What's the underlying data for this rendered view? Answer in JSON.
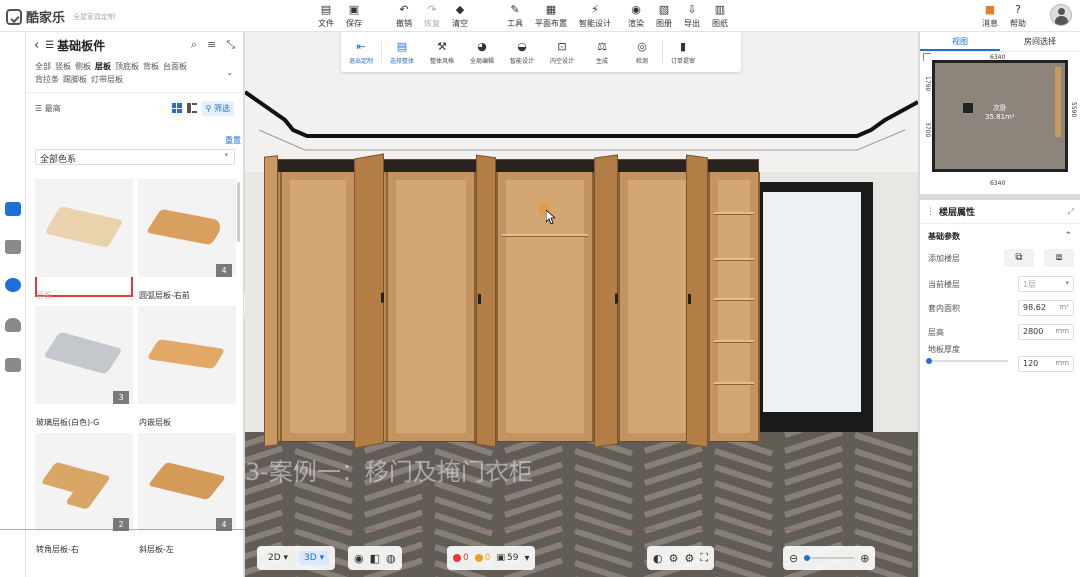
{
  "app": {
    "logo_text": "酷家乐",
    "logo_sub": "全屋家具定制"
  },
  "toolbar": {
    "file": "文件",
    "save": "保存",
    "undo": "撤销",
    "redo": "恢复",
    "clear": "清空",
    "tools": "工具",
    "layout": "平面布置",
    "smart_design": "智能设计",
    "render": "渲染",
    "gallery": "图册",
    "export": "导出",
    "drawings": "图纸",
    "messages": "消息",
    "help": "帮助"
  },
  "left_panel": {
    "title": "基础板件",
    "categories": [
      "全部",
      "竖板",
      "侧板",
      "层板",
      "顶底板",
      "背板",
      "台面板",
      "背拉条",
      "踢脚板",
      "灯带层板"
    ],
    "active_category": "层板",
    "sort_label": "最高",
    "filter_label": "筛选",
    "reset_label": "重置",
    "color_select": "全部色系",
    "products": [
      {
        "name": "层板",
        "badge": "",
        "selected": true,
        "color": "#ead2ad"
      },
      {
        "name": "圆弧层板-右前",
        "badge": "4",
        "selected": false,
        "color": "#d7a05f"
      },
      {
        "name": "玻璃层板(白色)-G",
        "badge": "3",
        "selected": false,
        "color": "#c4c7cb"
      },
      {
        "name": "内嵌层板",
        "badge": "",
        "selected": false,
        "color": "#e2a866"
      },
      {
        "name": "转角层板-右",
        "badge": "2",
        "selected": false,
        "color": "#d9a765"
      },
      {
        "name": "斜层板-左",
        "badge": "4",
        "selected": false,
        "color": "#d49a58"
      }
    ]
  },
  "context_toolbar": {
    "exit": "退出定制",
    "select_all": "选择整体",
    "whole_style": "整体风格",
    "global_edit": "全局编辑",
    "smart": "智能设计",
    "inner_space": "内空设计",
    "generate": "生成",
    "check": "检测",
    "order": "订单提审"
  },
  "viewport": {
    "watermark": "3-案例一：移门及掩门衣柜",
    "view_2d": "2D",
    "view_3d": "3D",
    "errors": "0",
    "warnings": "0",
    "count": "59"
  },
  "mini_map": {
    "tab_view": "视图",
    "tab_room": "房间选择",
    "room_name": "次卧",
    "room_area": "35.81m²",
    "dim_top": "6340",
    "dim_bottom": "6340",
    "dim_left_top": "1790",
    "dim_left_bottom": "3700",
    "dim_right": "5590"
  },
  "properties": {
    "title": "楼层属性",
    "section": "基础参数",
    "add_floor": "添加楼层",
    "current_floor": "当前楼层",
    "current_floor_value": "1层",
    "inner_area": "套内面积",
    "inner_area_value": "98.62",
    "inner_area_unit": "m²",
    "floor_height": "层高",
    "floor_height_value": "2800",
    "floor_height_unit": "mm",
    "floor_thickness": "地板厚度",
    "floor_thickness_value": "120",
    "floor_thickness_unit": "mm"
  },
  "colors": {
    "accent": "#1e6fd9",
    "selection": "#e53935",
    "wood": "#c79860"
  }
}
